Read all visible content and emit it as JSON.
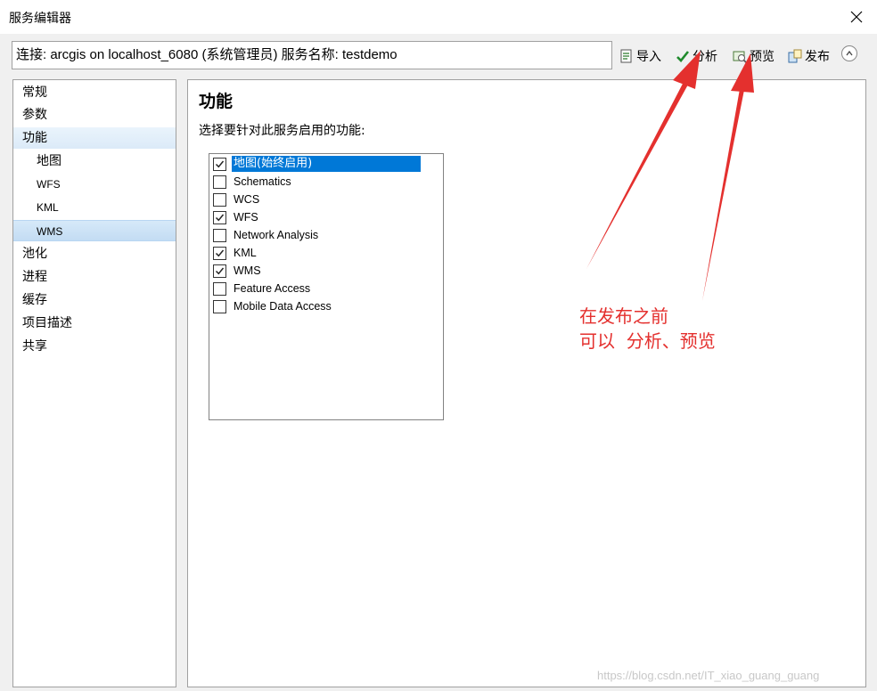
{
  "window": {
    "title": "服务编辑器"
  },
  "connection": {
    "value": "连接: arcgis on localhost_6080 (系统管理员)   服务名称: testdemo"
  },
  "toolbar": {
    "import_label": "导入",
    "analyze_label": "分析",
    "preview_label": "预览",
    "publish_label": "发布"
  },
  "nav": {
    "items": [
      {
        "label": "常规"
      },
      {
        "label": "参数"
      },
      {
        "label": "功能"
      },
      {
        "label": "地图"
      },
      {
        "label": "WFS"
      },
      {
        "label": "KML"
      },
      {
        "label": "WMS"
      },
      {
        "label": "池化"
      },
      {
        "label": "进程"
      },
      {
        "label": "缓存"
      },
      {
        "label": "项目描述"
      },
      {
        "label": "共享"
      }
    ]
  },
  "main": {
    "heading": "功能",
    "prompt": "选择要针对此服务启用的功能:",
    "capabilities": [
      {
        "label": "地图(始终启用)",
        "checked": true
      },
      {
        "label": "Schematics",
        "checked": false
      },
      {
        "label": "WCS",
        "checked": false
      },
      {
        "label": "WFS",
        "checked": true
      },
      {
        "label": "Network Analysis",
        "checked": false
      },
      {
        "label": "KML",
        "checked": true
      },
      {
        "label": "WMS",
        "checked": true
      },
      {
        "label": "Feature Access",
        "checked": false
      },
      {
        "label": "Mobile Data Access",
        "checked": false
      }
    ]
  },
  "annotation": {
    "line1": "在发布之前",
    "line2": "可以  分析、预览",
    "color": "#e4302e"
  },
  "watermark": "https://blog.csdn.net/IT_xiao_guang_guang"
}
